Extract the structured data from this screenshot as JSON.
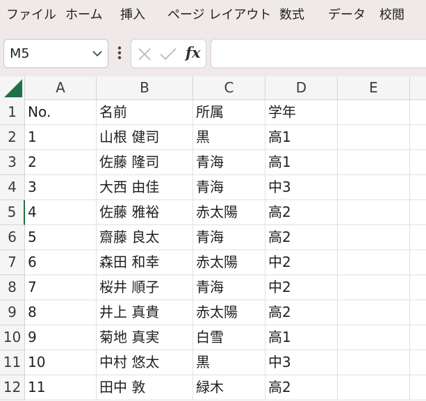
{
  "ribbon": {
    "tabs": [
      "ファイル",
      "ホーム",
      "挿入",
      "ページ レイアウト",
      "数式",
      "データ",
      "校閲"
    ]
  },
  "formula_bar": {
    "name_box": "M5",
    "function_symbol": "fx",
    "formula_value": ""
  },
  "sheet": {
    "columns": [
      "A",
      "B",
      "C",
      "D",
      "E"
    ],
    "active_row": 5,
    "rows": [
      {
        "row": "1",
        "cells": [
          "No.",
          "名前",
          "所属",
          "学年",
          ""
        ]
      },
      {
        "row": "2",
        "cells": [
          "1",
          "山根 健司",
          "黒",
          "高1",
          ""
        ]
      },
      {
        "row": "3",
        "cells": [
          "2",
          "佐藤 隆司",
          "青海",
          "高1",
          ""
        ]
      },
      {
        "row": "4",
        "cells": [
          "3",
          "大西 由佳",
          "青海",
          "中3",
          ""
        ]
      },
      {
        "row": "5",
        "cells": [
          "4",
          "佐藤 雅裕",
          "赤太陽",
          "高2",
          ""
        ]
      },
      {
        "row": "6",
        "cells": [
          "5",
          "齋藤 良太",
          "青海",
          "高2",
          ""
        ]
      },
      {
        "row": "7",
        "cells": [
          "6",
          "森田 和幸",
          "赤太陽",
          "中2",
          ""
        ]
      },
      {
        "row": "8",
        "cells": [
          "7",
          "桜井 順子",
          "青海",
          "中2",
          ""
        ]
      },
      {
        "row": "9",
        "cells": [
          "8",
          "井上 真貴",
          "赤太陽",
          "高2",
          ""
        ]
      },
      {
        "row": "10",
        "cells": [
          "9",
          "菊地 真実",
          "白雪",
          "高1",
          ""
        ]
      },
      {
        "row": "11",
        "cells": [
          "10",
          "中村 悠太",
          "黒",
          "中3",
          ""
        ]
      },
      {
        "row": "12",
        "cells": [
          "11",
          "田中 敦",
          "緑木",
          "高2",
          ""
        ]
      }
    ]
  },
  "colors": {
    "ribbon_bg": "#efe9e9",
    "accent_green": "#1e7145"
  }
}
